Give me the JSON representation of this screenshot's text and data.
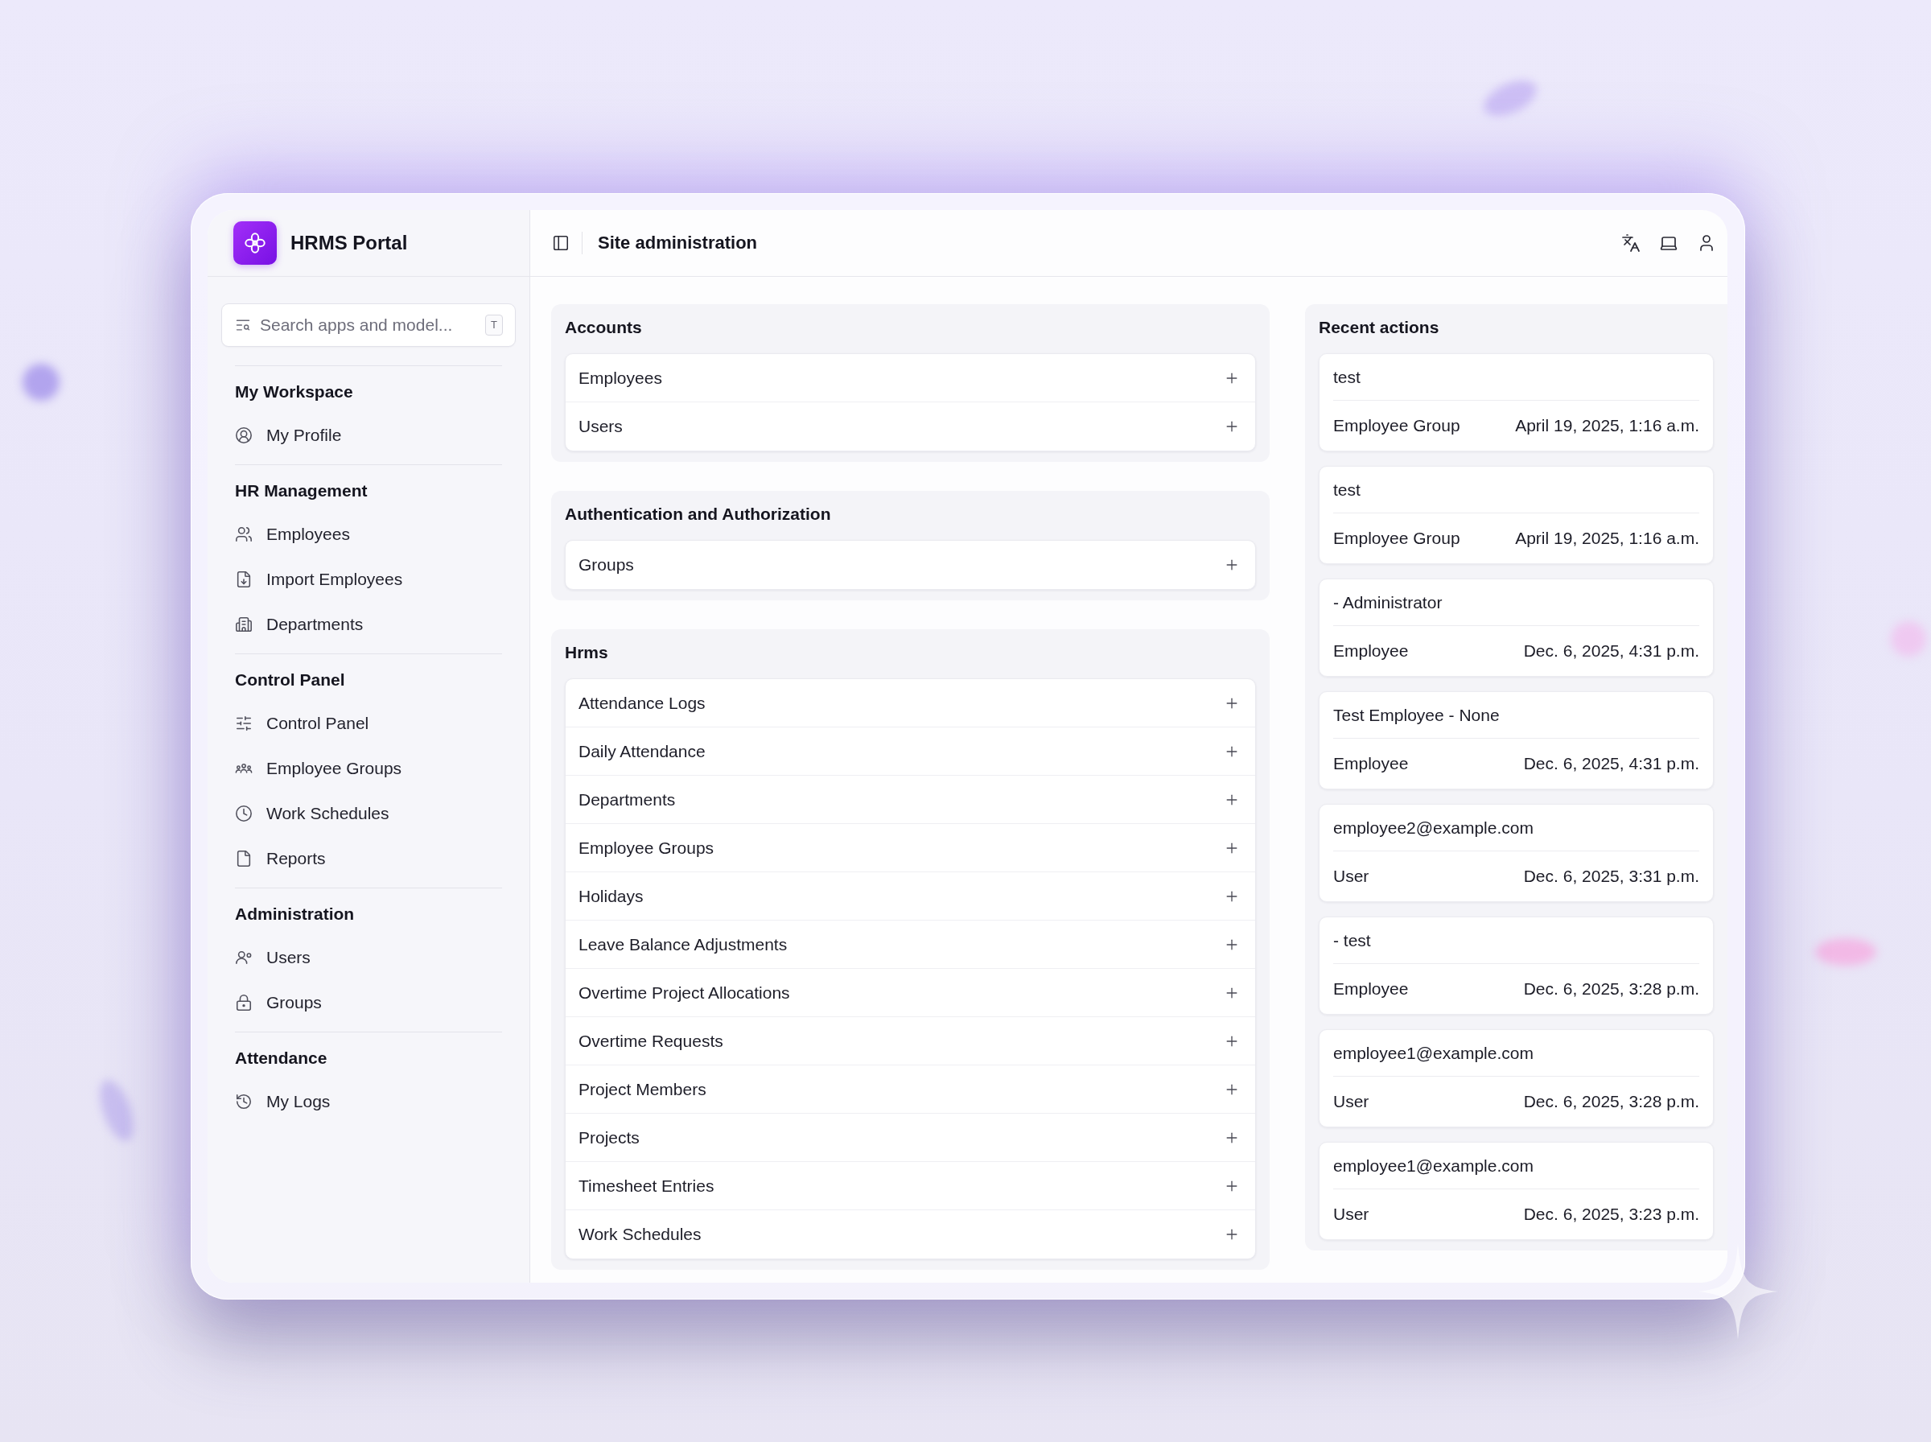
{
  "app": {
    "name": "HRMS Portal"
  },
  "search": {
    "placeholder": "Search apps and model...",
    "shortcut": "T"
  },
  "sidebar": {
    "sections": [
      {
        "title": "My Workspace",
        "items": [
          "My Profile"
        ]
      },
      {
        "title": "HR Management",
        "items": [
          "Employees",
          "Import Employees",
          "Departments"
        ]
      },
      {
        "title": "Control Panel",
        "items": [
          "Control Panel",
          "Employee Groups",
          "Work Schedules",
          "Reports"
        ]
      },
      {
        "title": "Administration",
        "items": [
          "Users",
          "Groups"
        ]
      },
      {
        "title": "Attendance",
        "items": [
          "My Logs"
        ]
      }
    ]
  },
  "header": {
    "title": "Site administration"
  },
  "apps": [
    {
      "name": "Accounts",
      "models": [
        "Employees",
        "Users"
      ]
    },
    {
      "name": "Authentication and Authorization",
      "models": [
        "Groups"
      ]
    },
    {
      "name": "Hrms",
      "models": [
        "Attendance Logs",
        "Daily Attendance",
        "Departments",
        "Employee Groups",
        "Holidays",
        "Leave Balance Adjustments",
        "Overtime Project Allocations",
        "Overtime Requests",
        "Project Members",
        "Projects",
        "Timesheet Entries",
        "Work Schedules"
      ]
    }
  ],
  "recent_actions": {
    "title": "Recent actions",
    "items": [
      {
        "object": "test",
        "type": "Employee Group",
        "time": "April 19, 2025, 1:16 a.m."
      },
      {
        "object": "test",
        "type": "Employee Group",
        "time": "April 19, 2025, 1:16 a.m."
      },
      {
        "object": "- Administrator",
        "type": "Employee",
        "time": "Dec. 6, 2025, 4:31 p.m."
      },
      {
        "object": "Test Employee - None",
        "type": "Employee",
        "time": "Dec. 6, 2025, 4:31 p.m."
      },
      {
        "object": "employee2@example.com",
        "type": "User",
        "time": "Dec. 6, 2025, 3:31 p.m."
      },
      {
        "object": "- test",
        "type": "Employee",
        "time": "Dec. 6, 2025, 3:28 p.m."
      },
      {
        "object": "employee1@example.com",
        "type": "User",
        "time": "Dec. 6, 2025, 3:28 p.m."
      },
      {
        "object": "employee1@example.com",
        "type": "User",
        "time": "Dec. 6, 2025, 3:23 p.m."
      }
    ]
  }
}
